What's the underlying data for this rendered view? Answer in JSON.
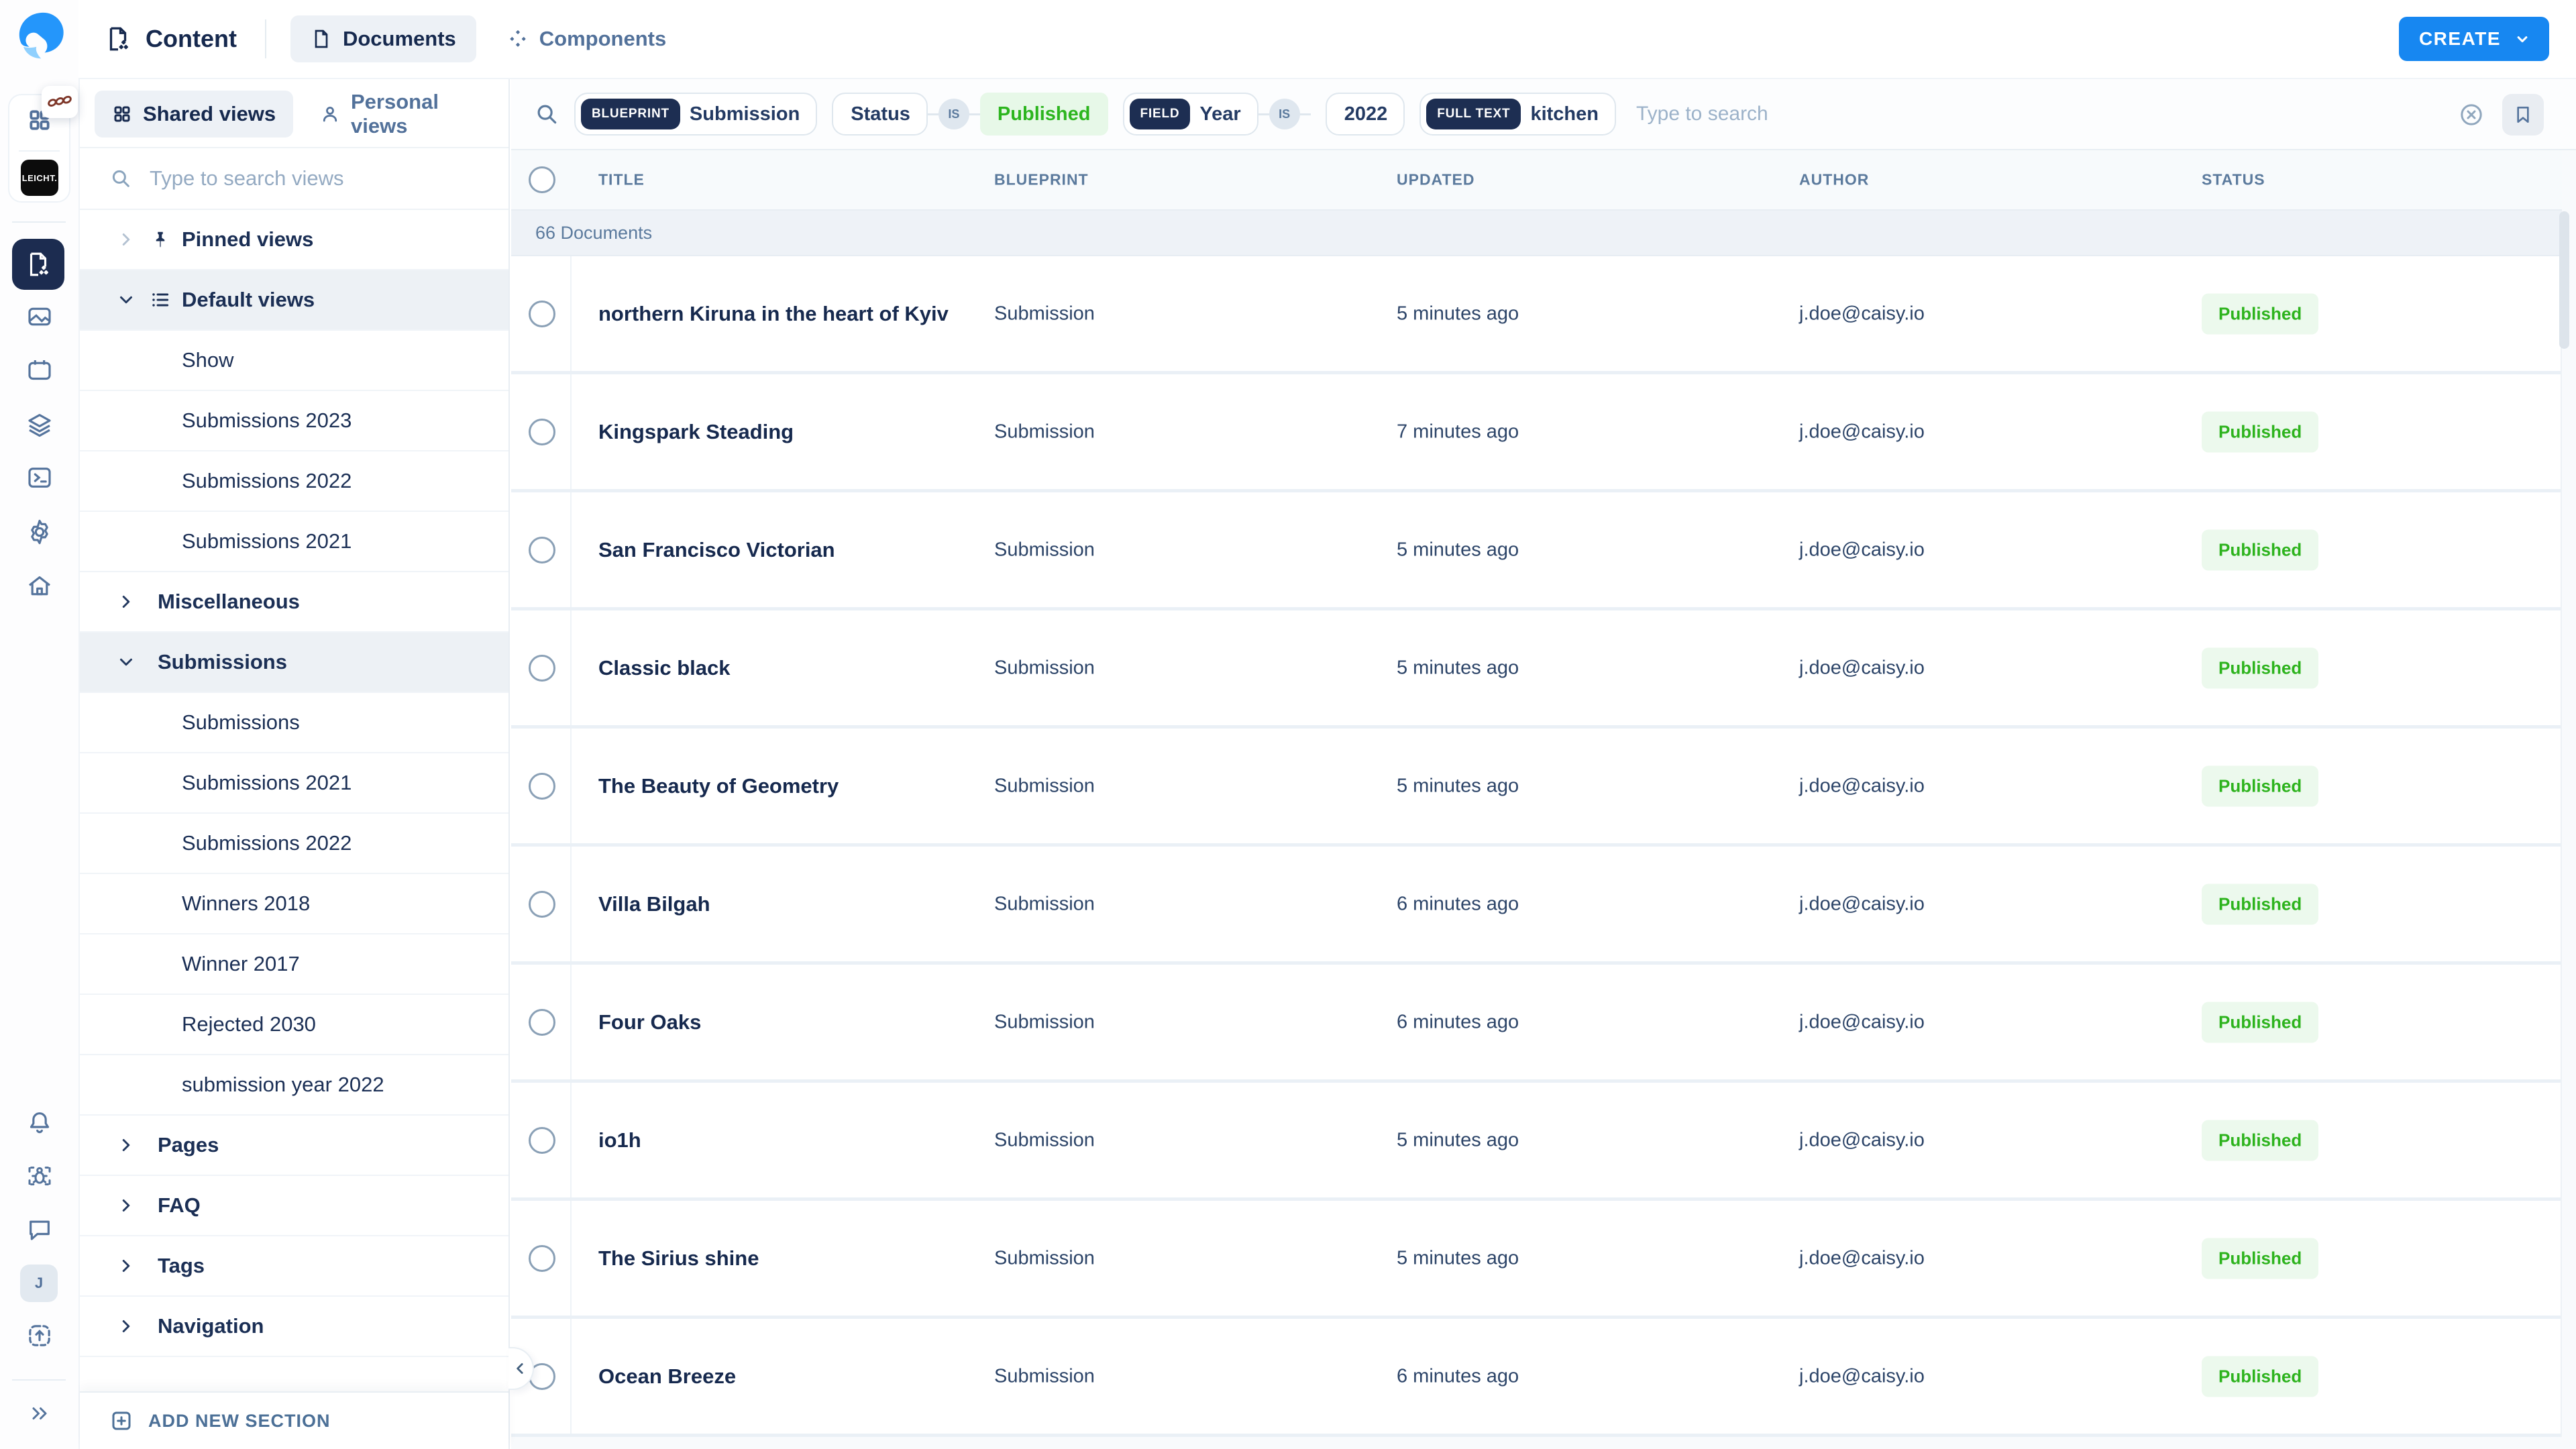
{
  "colors": {
    "accent_blue": "#1787f1",
    "published_green": "#2db31d",
    "tag_navy": "#1d2e52",
    "badge_green_bg": "#ecf9ed"
  },
  "rail": {
    "workspace_logo": "LEICHT.",
    "avatar_initial": "J"
  },
  "header": {
    "app_title": "Content",
    "tabs": [
      {
        "label": "Documents"
      },
      {
        "label": "Components"
      }
    ],
    "create_label": "CREATE"
  },
  "sidebar": {
    "tabs": [
      {
        "label": "Shared views"
      },
      {
        "label": "Personal views"
      }
    ],
    "search_placeholder": "Type to search views",
    "items": [
      {
        "label": "Pinned views"
      },
      {
        "label": "Default views"
      },
      {
        "label": "Show"
      },
      {
        "label": "Submissions 2023"
      },
      {
        "label": "Submissions 2022"
      },
      {
        "label": "Submissions 2021"
      },
      {
        "label": "Miscellaneous"
      },
      {
        "label": "Submissions"
      },
      {
        "label": "Submissions"
      },
      {
        "label": "Submissions 2021"
      },
      {
        "label": "Submissions 2022"
      },
      {
        "label": "Winners 2018"
      },
      {
        "label": "Winner 2017"
      },
      {
        "label": "Rejected 2030"
      },
      {
        "label": "submission year 2022"
      },
      {
        "label": "Pages"
      },
      {
        "label": "FAQ"
      },
      {
        "label": "Tags"
      },
      {
        "label": "Navigation"
      }
    ],
    "add_section_label": "ADD NEW SECTION"
  },
  "filters": {
    "blueprint": {
      "tag": "BLUEPRINT",
      "value": "Submission"
    },
    "status": {
      "name": "Status",
      "op": "IS",
      "value": "Published"
    },
    "year": {
      "tag": "FIELD",
      "name": "Year",
      "op": "IS",
      "value": "2022"
    },
    "fulltext": {
      "tag": "FULL TEXT",
      "value": "kitchen"
    },
    "search_placeholder": "Type to search"
  },
  "table": {
    "columns": [
      "TITLE",
      "BLUEPRINT",
      "UPDATED",
      "AUTHOR",
      "STATUS"
    ],
    "count_label": "66 Documents",
    "rows": [
      {
        "title": "northern Kiruna in the heart of Kyiv",
        "blueprint": "Submission",
        "updated": "5 minutes ago",
        "author": "j.doe@caisy.io",
        "status": "Published"
      },
      {
        "title": "Kingspark Steading",
        "blueprint": "Submission",
        "updated": "7 minutes ago",
        "author": "j.doe@caisy.io",
        "status": "Published"
      },
      {
        "title": "San Francisco Victorian",
        "blueprint": "Submission",
        "updated": "5 minutes ago",
        "author": "j.doe@caisy.io",
        "status": "Published"
      },
      {
        "title": "Classic black",
        "blueprint": "Submission",
        "updated": "5 minutes ago",
        "author": "j.doe@caisy.io",
        "status": "Published"
      },
      {
        "title": "The Beauty of Geometry",
        "blueprint": "Submission",
        "updated": "5 minutes ago",
        "author": "j.doe@caisy.io",
        "status": "Published"
      },
      {
        "title": "Villa Bilgah",
        "blueprint": "Submission",
        "updated": "6 minutes ago",
        "author": "j.doe@caisy.io",
        "status": "Published"
      },
      {
        "title": "Four Oaks",
        "blueprint": "Submission",
        "updated": "6 minutes ago",
        "author": "j.doe@caisy.io",
        "status": "Published"
      },
      {
        "title": "io1h",
        "blueprint": "Submission",
        "updated": "5 minutes ago",
        "author": "j.doe@caisy.io",
        "status": "Published"
      },
      {
        "title": "The Sirius shine",
        "blueprint": "Submission",
        "updated": "5 minutes ago",
        "author": "j.doe@caisy.io",
        "status": "Published"
      },
      {
        "title": "Ocean Breeze",
        "blueprint": "Submission",
        "updated": "6 minutes ago",
        "author": "j.doe@caisy.io",
        "status": "Published"
      }
    ]
  }
}
